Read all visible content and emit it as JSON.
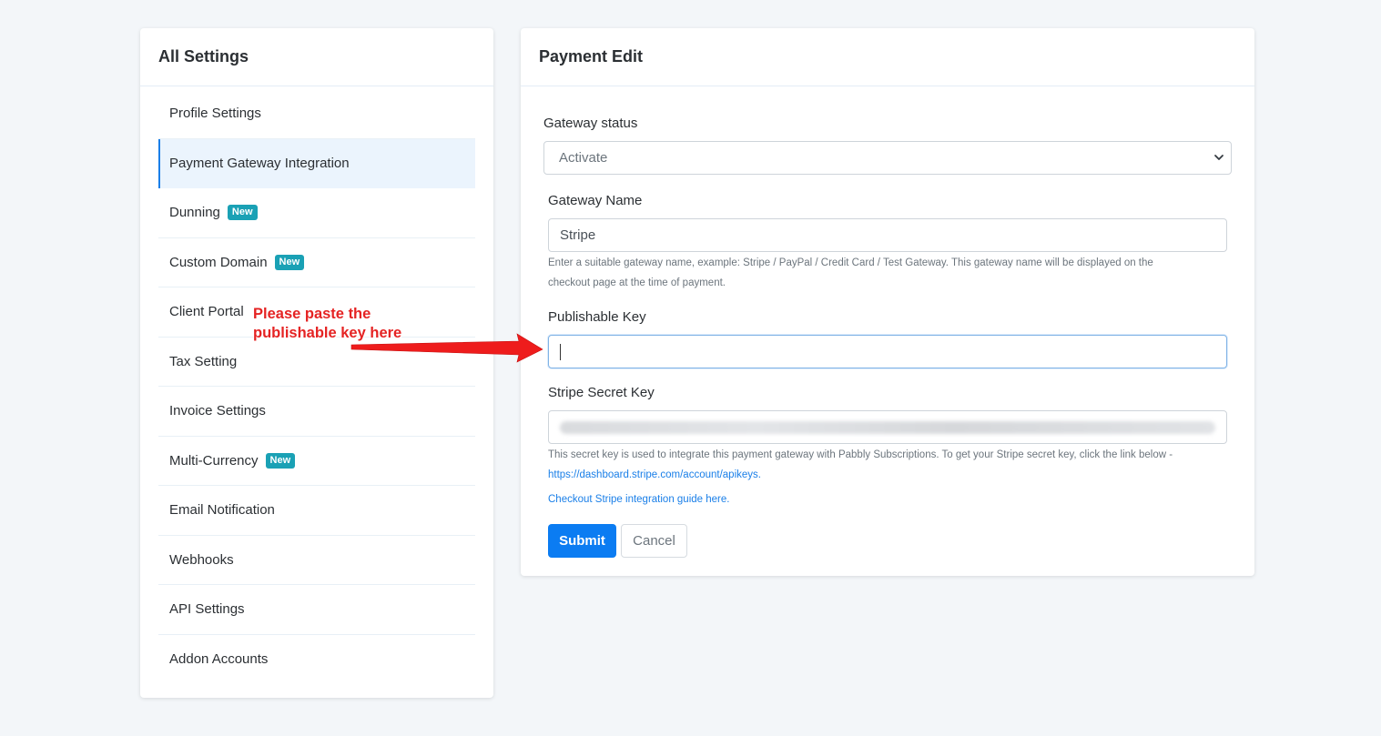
{
  "sidebar": {
    "title": "All Settings",
    "items": [
      {
        "label": "Profile Settings",
        "badge": ""
      },
      {
        "label": "Payment Gateway Integration",
        "badge": ""
      },
      {
        "label": "Dunning",
        "badge": "New"
      },
      {
        "label": "Custom Domain",
        "badge": "New"
      },
      {
        "label": "Client Portal",
        "badge": ""
      },
      {
        "label": "Tax Setting",
        "badge": ""
      },
      {
        "label": "Invoice Settings",
        "badge": ""
      },
      {
        "label": "Multi-Currency",
        "badge": "New"
      },
      {
        "label": "Email Notification",
        "badge": ""
      },
      {
        "label": "Webhooks",
        "badge": ""
      },
      {
        "label": "API Settings",
        "badge": ""
      },
      {
        "label": "Addon Accounts",
        "badge": ""
      }
    ],
    "active_index": 1
  },
  "main": {
    "title": "Payment Edit",
    "gateway_status": {
      "label": "Gateway status",
      "value": "Activate"
    },
    "gateway_name": {
      "label": "Gateway Name",
      "value": "Stripe",
      "help_line1": "Enter a suitable gateway name, example: Stripe / PayPal / Credit Card / Test Gateway. This gateway name will be displayed on the",
      "help_line2": "checkout page at the time of payment."
    },
    "publishable_key": {
      "label": "Publishable Key",
      "value": ""
    },
    "secret_key": {
      "label": "Stripe Secret Key",
      "help_line1": "This secret key is used to integrate this payment gateway with Pabbly Subscriptions. To get your Stripe secret key, click the link below -",
      "help_link": "https://dashboard.stripe.com/account/apikeys.",
      "guide_link": "Checkout Stripe integration guide here."
    },
    "submit_label": "Submit",
    "cancel_label": "Cancel"
  },
  "annotation": {
    "line1": "Please paste the",
    "line2": "publishable key here",
    "color": "#e52323"
  }
}
